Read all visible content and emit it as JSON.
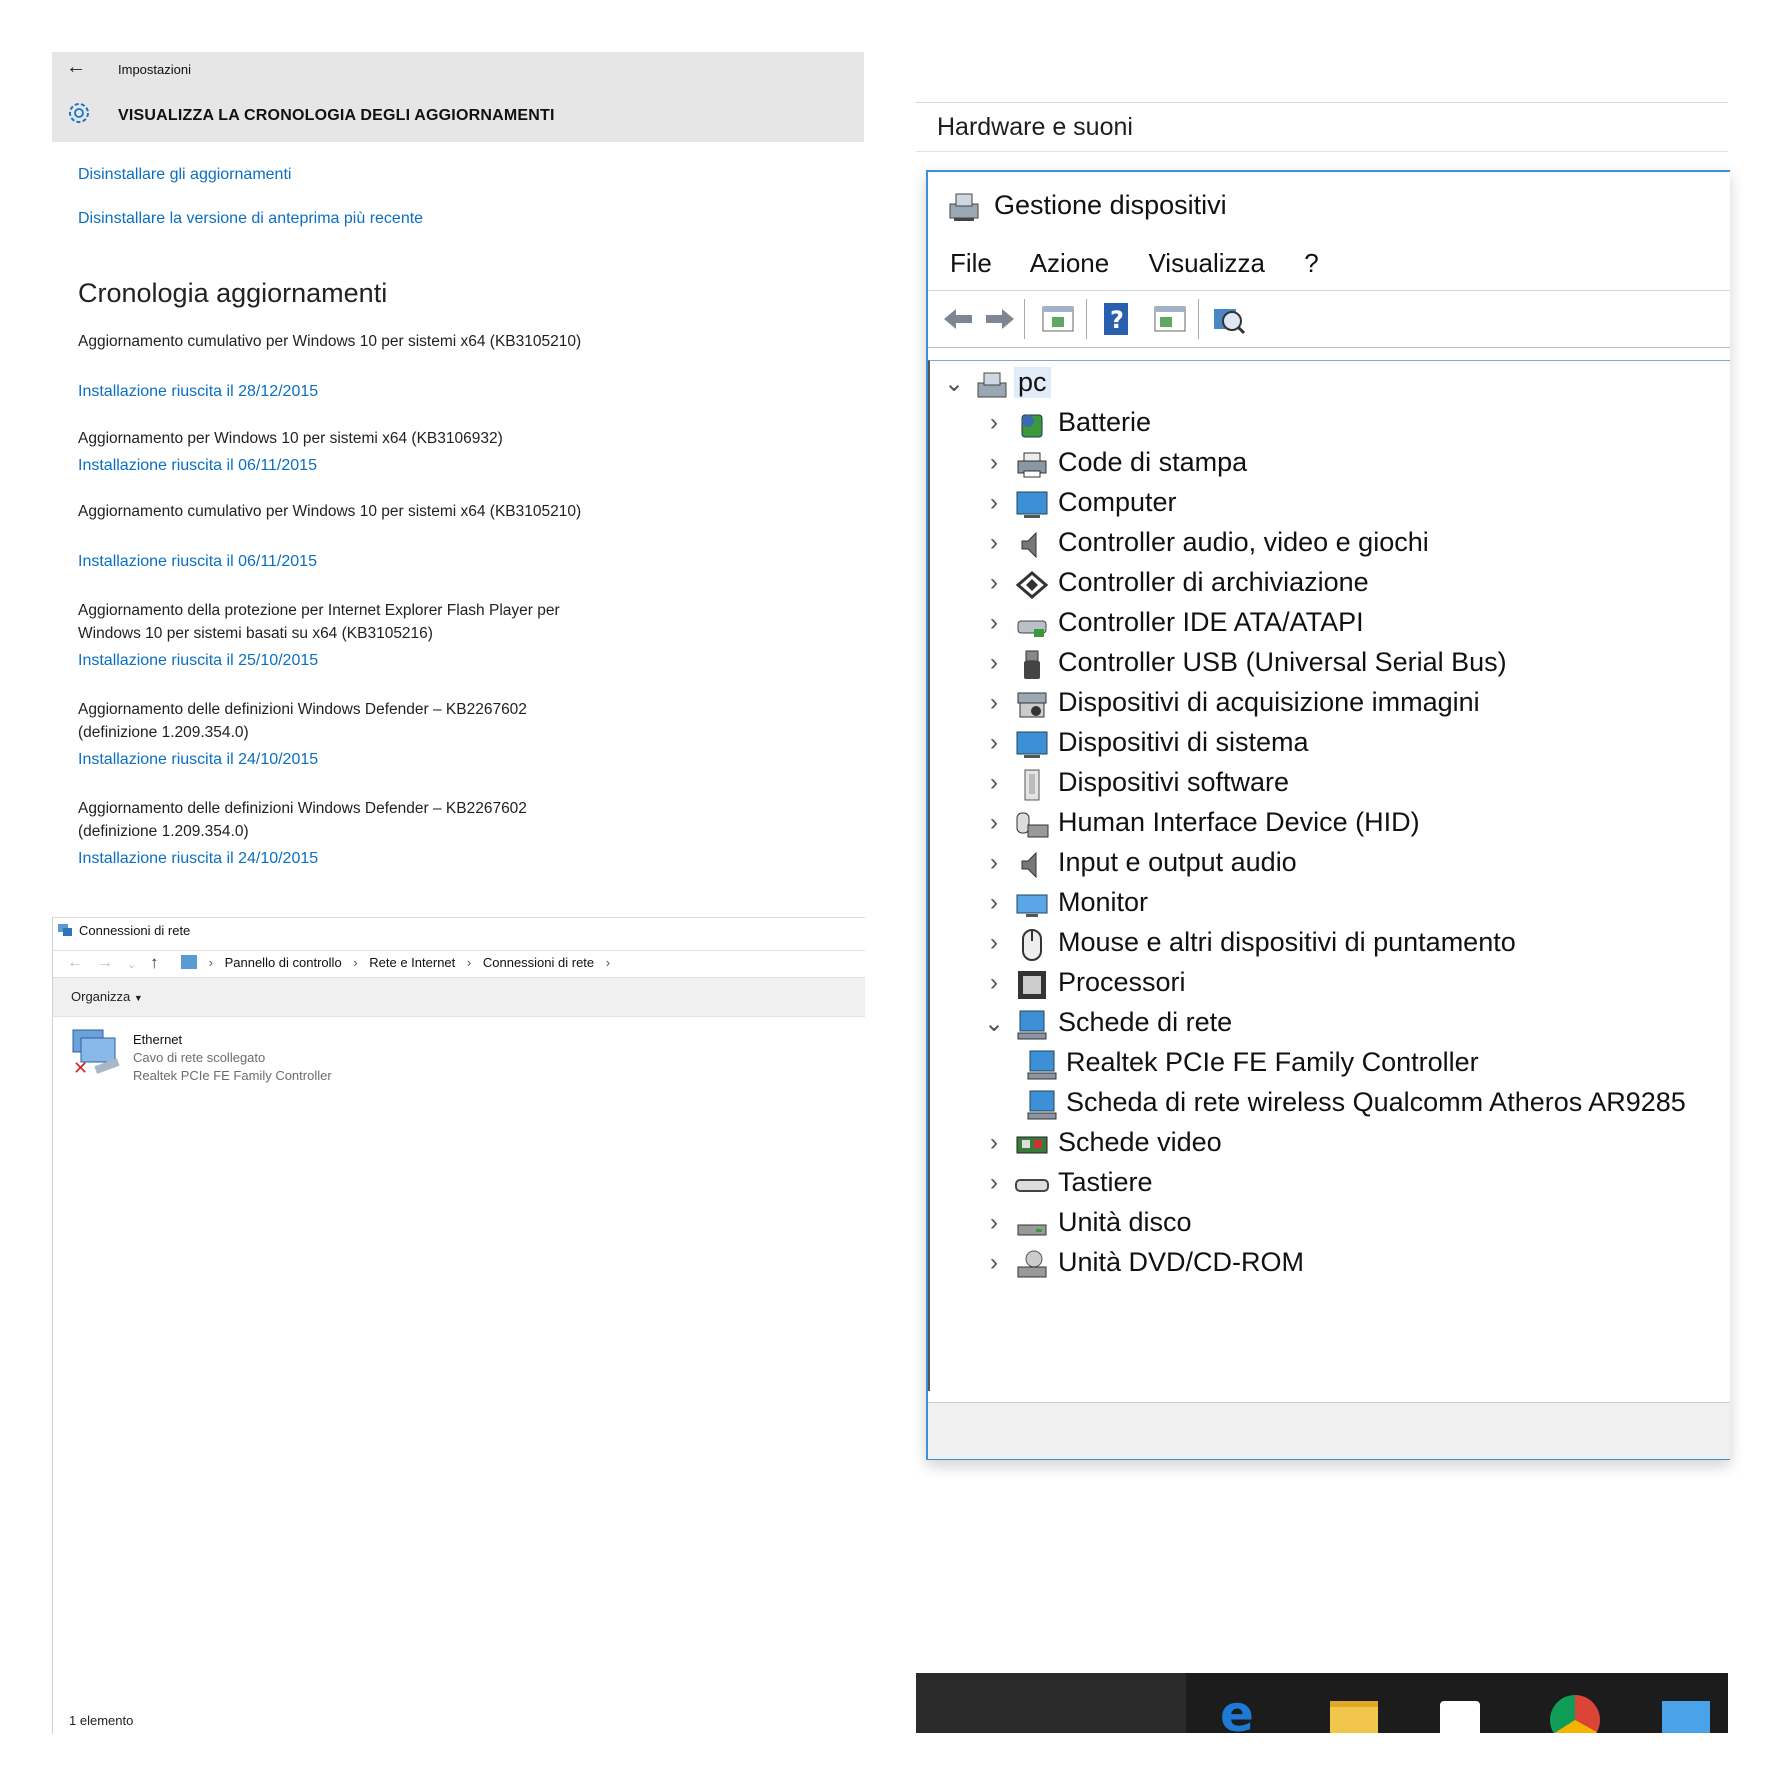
{
  "settings": {
    "app_title": "Impostazioni",
    "page_title": "VISUALIZZA LA CRONOLOGIA DEGLI AGGIORNAMENTI",
    "links": [
      "Disinstallare gli aggiornamenti",
      "Disinstallare la versione di anteprima più recente"
    ],
    "heading": "Cronologia aggiornamenti",
    "updates": [
      {
        "name": "Aggiornamento cumulativo per Windows 10 per sistemi x64 (KB3105210)",
        "status": "Installazione riuscita il 28/12/2015"
      },
      {
        "name": "Aggiornamento per Windows 10 per sistemi x64 (KB3106932)",
        "status": "Installazione riuscita il 06/11/2015"
      },
      {
        "name": "Aggiornamento cumulativo per Windows 10 per sistemi x64 (KB3105210)",
        "status": "Installazione riuscita il 06/11/2015"
      },
      {
        "name": "Aggiornamento della protezione per Internet Explorer Flash Player per Windows 10 per sistemi basati su x64 (KB3105216)",
        "status": "Installazione riuscita il 25/10/2015"
      },
      {
        "name": "Aggiornamento delle definizioni Windows Defender – KB2267602 (definizione 1.209.354.0)",
        "status": "Installazione riuscita il 24/10/2015"
      },
      {
        "name": "Aggiornamento delle definizioni Windows Defender – KB2267602 (definizione 1.209.354.0)",
        "status": "Installazione riuscita il 24/10/2015"
      }
    ]
  },
  "network": {
    "window_title": "Connessioni di rete",
    "breadcrumb": [
      "Pannello di controllo",
      "Rete e Internet",
      "Connessioni di rete"
    ],
    "organize_label": "Organizza",
    "adapter": {
      "name": "Ethernet",
      "status": "Cavo di rete scollegato",
      "device": "Realtek PCIe FE Family Controller"
    },
    "status_bar": "1 elemento"
  },
  "hardware_header": "Hardware e suoni",
  "device_manager": {
    "title": "Gestione dispositivi",
    "menu": [
      "File",
      "Azione",
      "Visualizza",
      "?"
    ],
    "root": "pc",
    "categories": [
      "Batterie",
      "Code di stampa",
      "Computer",
      "Controller audio, video e giochi",
      "Controller di archiviazione",
      "Controller IDE ATA/ATAPI",
      "Controller USB (Universal Serial Bus)",
      "Dispositivi di acquisizione immagini",
      "Dispositivi di sistema",
      "Dispositivi software",
      "Human Interface Device (HID)",
      "Input e output audio",
      "Monitor",
      "Mouse e altri dispositivi di puntamento",
      "Processori",
      "Schede di rete",
      "Schede video",
      "Tastiere",
      "Unità disco",
      "Unità DVD/CD-ROM"
    ],
    "network_adapters": [
      "Realtek PCIe FE Family Controller",
      "Scheda di rete wireless Qualcomm Atheros AR9285"
    ]
  },
  "colors": {
    "link": "#0a6fc2",
    "accent": "#3d8fd6",
    "selection": "#e1ecf8"
  }
}
